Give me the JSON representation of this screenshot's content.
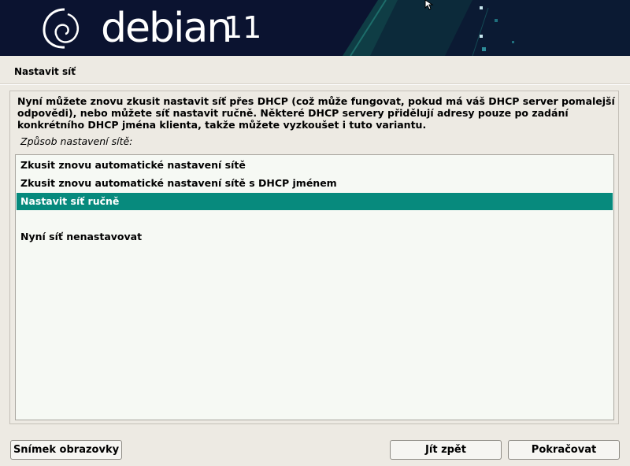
{
  "banner": {
    "brand": "debian",
    "version": "11"
  },
  "page": {
    "title": "Nastavit síť"
  },
  "main": {
    "description": "Nyní můžete znovu zkusit nastavit síť přes DHCP (což může fungovat, pokud má váš DHCP server pomalejší odpovědi), nebo můžete síť nastavit ručně. Některé DHCP servery přidělují adresy pouze po zadání konkrétního DHCP jména klienta, takže můžete vyzkoušet i tuto variantu.",
    "list_label": "Způsob nastavení sítě:",
    "options": [
      {
        "label": "Zkusit znovu automatické nastavení sítě",
        "selected": false
      },
      {
        "label": "Zkusit znovu automatické nastavení sítě s DHCP jménem",
        "selected": false
      },
      {
        "label": "Nastavit síť ručně",
        "selected": true
      },
      {
        "label": "",
        "selected": false
      },
      {
        "label": "Nyní síť nenastavovat",
        "selected": false
      }
    ]
  },
  "buttons": {
    "screenshot": "Snímek obrazovky",
    "back": "Jít zpět",
    "continue": "Pokračovat"
  },
  "colors": {
    "banner_bg": "#0b1330",
    "accent": "#078a7d",
    "page_bg": "#edeae3",
    "list_bg": "#f6f9f4"
  },
  "icons": {
    "logo": "debian-swirl-icon",
    "cursor": "mouse-pointer-icon"
  }
}
